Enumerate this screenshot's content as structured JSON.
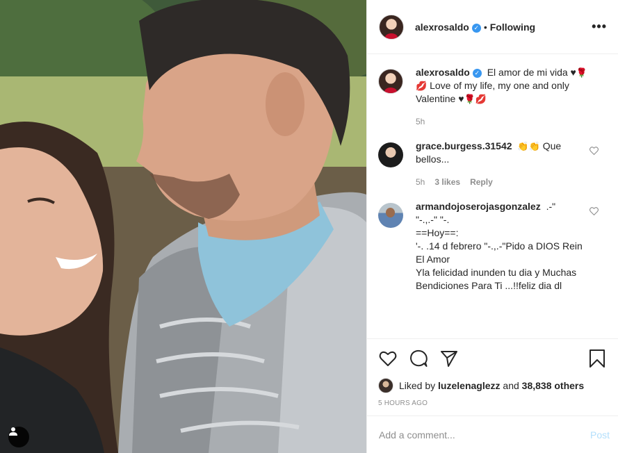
{
  "post": {
    "owner": "alexrosaldo",
    "follow_separator": "•",
    "follow_state": "Following",
    "more_label": "•••"
  },
  "comments": [
    {
      "username": "alexrosaldo",
      "text_1": "El amor de mi vida ♥",
      "text_2": "Love of my life, my one and only Valentine ♥",
      "emoji_rose": "🌹",
      "emoji_kiss": "💋",
      "age": "5h"
    },
    {
      "username": "grace.burgess.31542",
      "emoji_clap": "👏",
      "text": "Que bellos...",
      "age": "5h",
      "likes": "3 likes",
      "reply": "Reply"
    },
    {
      "username": "armandojoserojasgonzalez",
      "text": ".-\"\n\"-.,.-\" \"-.\n==Hoy==:\n'-. .14 d febrero \"-.,.-\"Pido a DIOS Rein\nEl Amor\nYla felicidad inunden tu dia y Muchas\nBendiciones Para Ti ...!!feliz dia dl"
    }
  ],
  "likes": {
    "prefix": "Liked by",
    "user": "luzelenaglezz",
    "conj": "and",
    "others": "38,838 others"
  },
  "timestamp": "5 HOURS AGO",
  "add_comment": {
    "placeholder": "Add a comment...",
    "post_label": "Post"
  },
  "icons": {
    "like": "heart-icon",
    "comment": "comment-icon",
    "share": "paper-plane-icon",
    "save": "bookmark-icon",
    "tag": "user-tag-icon"
  },
  "colors": {
    "verified": "#3897f0",
    "post_disabled": "#b2dffc",
    "muted": "#8e8e8e"
  }
}
